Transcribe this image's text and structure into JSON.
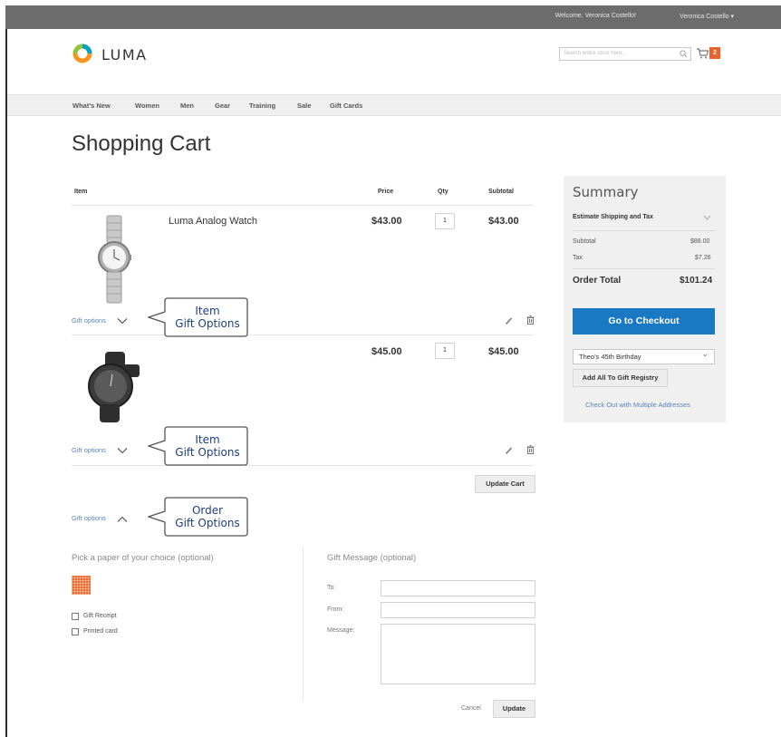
{
  "topbar": {
    "welcome": "Welcome, Veronica Costello!",
    "user_menu": "Veronica Costello"
  },
  "header": {
    "logo_text": "LUMA",
    "search_placeholder": "Search entire store here...",
    "cart_count": "2"
  },
  "nav": {
    "items": [
      "What's New",
      "Women",
      "Men",
      "Gear",
      "Training",
      "Sale",
      "Gift Cards"
    ]
  },
  "page": {
    "title": "Shopping Cart"
  },
  "cart": {
    "headers": {
      "item": "Item",
      "price": "Price",
      "qty": "Qty",
      "subtotal": "Subtotal"
    },
    "items": [
      {
        "name": "Luma Analog Watch",
        "price": "$43.00",
        "qty": "1",
        "subtotal": "$43.00",
        "gift_link": "Gift options"
      },
      {
        "name": "",
        "price": "$45.00",
        "qty": "1",
        "subtotal": "$45.00",
        "gift_link": "Gift options"
      }
    ],
    "update_cart": "Update Cart",
    "order_gift_link": "Gift options"
  },
  "callouts": {
    "item1": {
      "line1": "Item",
      "line2": "Gift Options"
    },
    "item2": {
      "line1": "Item",
      "line2": "Gift Options"
    },
    "order": {
      "line1": "Order",
      "line2": "Gift Options"
    }
  },
  "gift_form": {
    "paper_label": "Pick a paper of your choice (optional)",
    "gift_receipt": "Gift Receipt",
    "printed_card": "Printed card",
    "message_title": "Gift Message (optional)",
    "to_label": "To:",
    "from_label": "From:",
    "message_label": "Message:",
    "cancel": "Cancel",
    "update": "Update"
  },
  "summary": {
    "title": "Summary",
    "estimate": "Estimate Shipping and Tax",
    "subtotal_label": "Subtotal",
    "subtotal_value": "$88.00",
    "tax_label": "Tax",
    "tax_value": "$7.26",
    "total_label": "Order Total",
    "total_value": "$101.24",
    "checkout": "Go to Checkout",
    "registry_selected": "Theo's 45th Birthday",
    "add_registry": "Add All To Gift Registry",
    "multi_address": "Check Out with Multiple Addresses"
  },
  "colors": {
    "accent": "#1979c3",
    "cart_badge": "#e9622c",
    "link": "#5a85b6",
    "callout_text": "#1e3f7d"
  }
}
